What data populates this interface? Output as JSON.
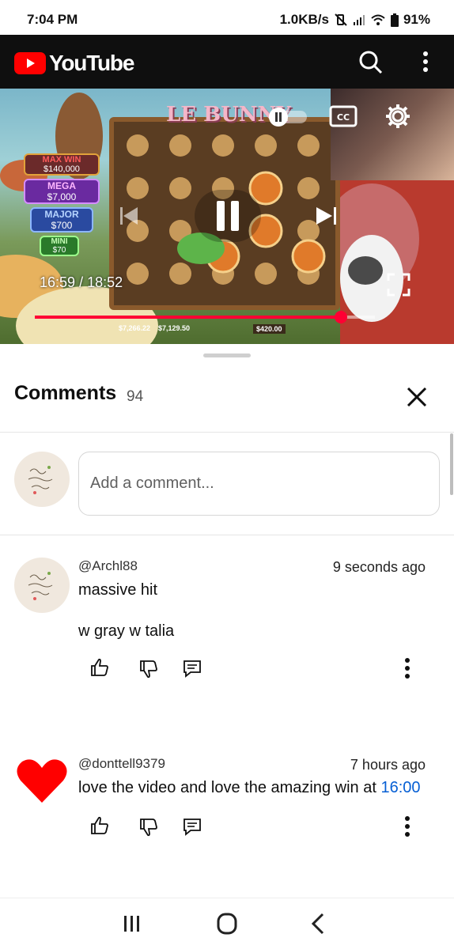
{
  "status_bar": {
    "time": "7:04 PM",
    "net_speed": "1.0KB/s",
    "battery": "91%",
    "icons": [
      "mute-vibrate-icon",
      "cell-signal-icon",
      "wifi-icon",
      "battery-icon"
    ]
  },
  "header": {
    "logo_text": "YouTube",
    "icons": [
      "search-icon",
      "more-vert-icon"
    ]
  },
  "player": {
    "current_time": "16:59",
    "duration": "18:52",
    "progress_fraction": 0.9,
    "game_labels": {
      "title": "LE BUNNY",
      "jackpots": [
        {
          "label": "MAX WIN",
          "value": "$140,000"
        },
        {
          "label": "MEGA",
          "value": "$7,000"
        },
        {
          "label": "MAJOR",
          "value": "$700"
        },
        {
          "label": "MINI",
          "value": "$70"
        }
      ],
      "balance": "$7,266.22",
      "win": "$7,129.50",
      "bet": "$420.00"
    },
    "accent": "#ff0033"
  },
  "comments": {
    "title": "Comments",
    "count": "94",
    "add_placeholder": "Add a comment...",
    "items": [
      {
        "author": "@Archl88",
        "time": "9 seconds ago",
        "lines": [
          "massive hit",
          "w gray w talia"
        ],
        "avatar": "avatar-sketch"
      },
      {
        "author": "@donttell9379",
        "time": "7 hours ago",
        "text_before": "love the video and love the amazing win at ",
        "timestamp_link": "16:00",
        "avatar": "heart-icon"
      }
    ]
  },
  "colors": {
    "link": "#065fd4",
    "header_bg": "#0f0f0f",
    "brand_red": "#ff0000"
  }
}
